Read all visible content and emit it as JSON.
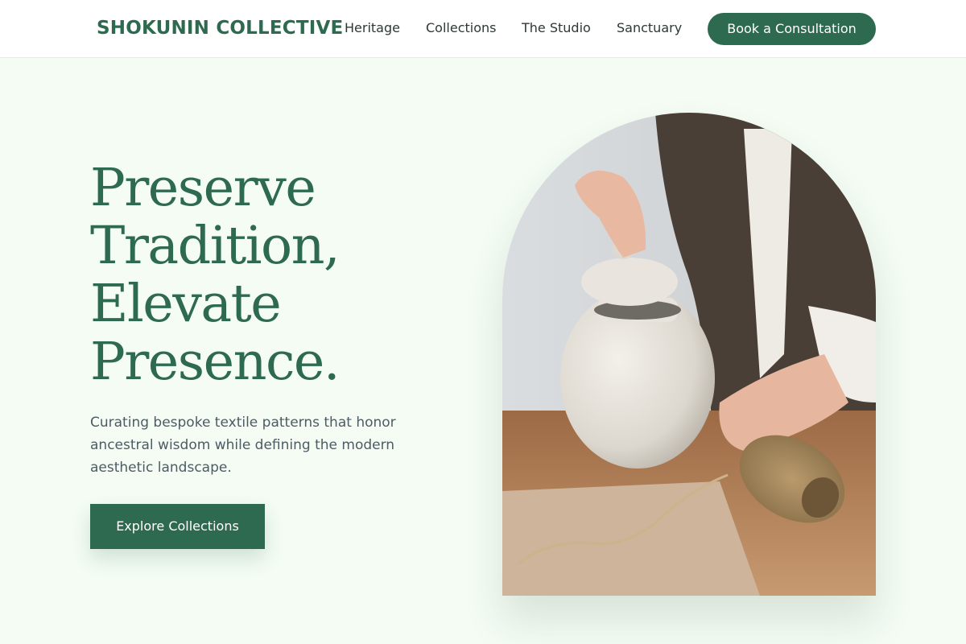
{
  "header": {
    "brand": "SHOKUNIN COLLECTIVE",
    "nav": [
      {
        "label": "Heritage"
      },
      {
        "label": "Collections"
      },
      {
        "label": "The Studio"
      },
      {
        "label": "Sanctuary"
      }
    ],
    "cta_label": "Book a Consultation"
  },
  "hero": {
    "headline_lines": [
      "Preserve",
      "Tradition,",
      "Elevate",
      "Presence."
    ],
    "subtext": "Curating bespoke textile patterns that honor ancestral wisdom while defining the modern aesthetic landscape.",
    "button_label": "Explore Collections",
    "image": {
      "subject": "artisan-hands-ceramic-jar-and-twine",
      "shape": "arch"
    }
  },
  "colors": {
    "brand_green": "#2e6a4f",
    "page_background": "#f4fcf4",
    "header_background": "#ffffff",
    "body_text": "#4d5b66"
  }
}
